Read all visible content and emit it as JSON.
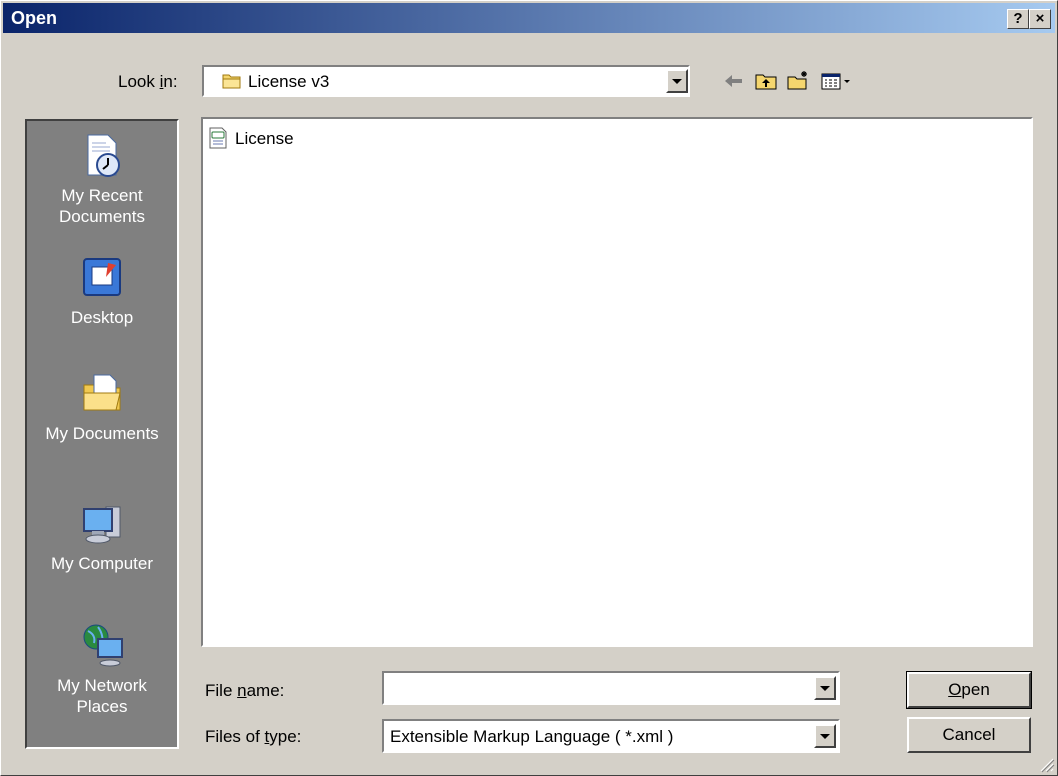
{
  "window": {
    "title": "Open",
    "help_btn": "?",
    "close_btn": "×"
  },
  "lookin": {
    "label": "Look in:",
    "label_pre": "Look ",
    "label_acc": "i",
    "label_post": "n:",
    "value": "License v3"
  },
  "toolbar": {
    "icons": [
      "back-arrow-icon",
      "up-folder-icon",
      "new-folder-icon",
      "views-menu-icon"
    ]
  },
  "places": [
    {
      "label": "My Recent Documents",
      "line1": "My Recent",
      "line2": "Documents",
      "icon": "recent-documents-icon"
    },
    {
      "label": "Desktop",
      "line1": "Desktop",
      "line2": "",
      "icon": "desktop-icon"
    },
    {
      "label": "My Documents",
      "line1": "My Documents",
      "line2": "",
      "icon": "my-documents-icon"
    },
    {
      "label": "My Computer",
      "line1": "My Computer",
      "line2": "",
      "icon": "my-computer-icon"
    },
    {
      "label": "My Network Places",
      "line1": "My Network",
      "line2": "Places",
      "icon": "network-places-icon"
    }
  ],
  "files": [
    {
      "name": "License",
      "icon": "xml-file-icon"
    }
  ],
  "filename": {
    "label_pre": "File ",
    "label_acc": "n",
    "label_post": "ame:",
    "value": ""
  },
  "filetype": {
    "label_pre": "Files of ",
    "label_acc": "t",
    "label_post": "ype:",
    "value": "Extensible Markup Language ( *.xml )"
  },
  "buttons": {
    "open_acc": "O",
    "open_rest": "pen",
    "cancel": "Cancel"
  },
  "colors": {
    "title_start": "#0a246a",
    "title_end": "#a6caf0",
    "face": "#d4d0c8",
    "places_bg": "#808080"
  }
}
